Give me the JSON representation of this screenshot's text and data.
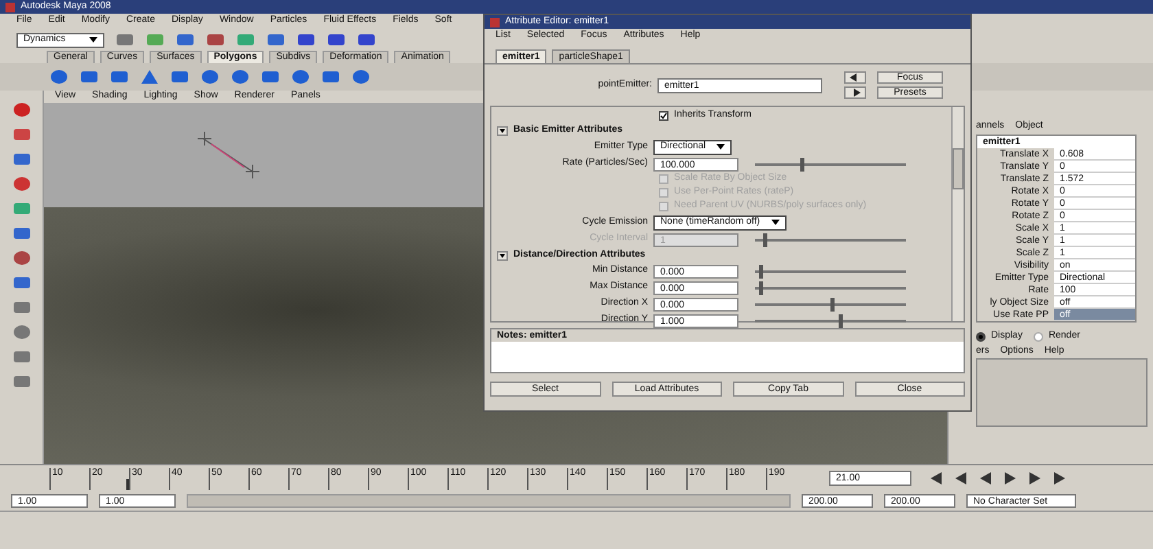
{
  "window": {
    "title": "Autodesk Maya 2008"
  },
  "menu_bar": [
    "File",
    "Edit",
    "Modify",
    "Create",
    "Display",
    "Window",
    "Particles",
    "Fluid Effects",
    "Fields",
    "Soft"
  ],
  "menu_set": {
    "value": "Dynamics"
  },
  "shelf_tabs": [
    {
      "label": "General",
      "selected": false
    },
    {
      "label": "Curves",
      "selected": false
    },
    {
      "label": "Surfaces",
      "selected": false
    },
    {
      "label": "Polygons",
      "selected": true
    },
    {
      "label": "Subdivs",
      "selected": false
    },
    {
      "label": "Deformation",
      "selected": false
    },
    {
      "label": "Animation",
      "selected": false
    }
  ],
  "viewport": {
    "menu": [
      "View",
      "Shading",
      "Lighting",
      "Show",
      "Renderer",
      "Panels"
    ]
  },
  "attribute_editor": {
    "title": "Attribute Editor: emitter1",
    "menu": [
      "List",
      "Selected",
      "Focus",
      "Attributes",
      "Help"
    ],
    "tabs": [
      {
        "label": "emitter1",
        "selected": true
      },
      {
        "label": "particleShape1",
        "selected": false
      }
    ],
    "node_label": "pointEmitter:",
    "node_value": "emitter1",
    "focus_button": "Focus",
    "presets_button": "Presets",
    "inherits": {
      "label": "Inherits Transform",
      "checked": true
    },
    "sections": [
      {
        "title": "Basic Emitter Attributes",
        "expanded": true,
        "rows": [
          {
            "kind": "dropdown",
            "label": "Emitter Type",
            "value": "Directional",
            "disabled": false
          },
          {
            "kind": "slider",
            "label": "Rate (Particles/Sec)",
            "value": "100.000",
            "level": 0.3,
            "disabled": false
          },
          {
            "kind": "checkbox",
            "label": "Scale Rate By Object Size",
            "checked": false,
            "disabled": true
          },
          {
            "kind": "checkbox",
            "label": "Use Per-Point Rates (rateP)",
            "checked": false,
            "disabled": true
          },
          {
            "kind": "checkbox",
            "label": "Need Parent UV (NURBS/poly surfaces only)",
            "checked": false,
            "disabled": true
          },
          {
            "kind": "dropdown",
            "label": "Cycle Emission",
            "value": "None (timeRandom off)",
            "disabled": false
          },
          {
            "kind": "slider",
            "label": "Cycle Interval",
            "value": "1",
            "level": 0.05,
            "disabled": true
          }
        ]
      },
      {
        "title": "Distance/Direction Attributes",
        "expanded": true,
        "rows": [
          {
            "kind": "slider",
            "label": "Min Distance",
            "value": "0.000",
            "level": 0.03,
            "disabled": false
          },
          {
            "kind": "slider",
            "label": "Max Distance",
            "value": "0.000",
            "level": 0.03,
            "disabled": false
          },
          {
            "kind": "slider",
            "label": "Direction X",
            "value": "0.000",
            "level": 0.5,
            "disabled": false
          },
          {
            "kind": "slider",
            "label": "Direction Y",
            "value": "1.000",
            "level": 0.55,
            "disabled": false
          }
        ]
      }
    ],
    "notes_label": "Notes:  emitter1",
    "buttons": [
      "Select",
      "Load Attributes",
      "Copy Tab",
      "Close"
    ]
  },
  "channel_box": {
    "tabs": [
      "annels",
      "Object"
    ],
    "node": "emitter1",
    "channels": [
      {
        "name": "Translate X",
        "value": "0.608",
        "selected": false
      },
      {
        "name": "Translate Y",
        "value": "0",
        "selected": false
      },
      {
        "name": "Translate Z",
        "value": "1.572",
        "selected": false
      },
      {
        "name": "Rotate X",
        "value": "0",
        "selected": false
      },
      {
        "name": "Rotate Y",
        "value": "0",
        "selected": false
      },
      {
        "name": "Rotate Z",
        "value": "0",
        "selected": false
      },
      {
        "name": "Scale X",
        "value": "1",
        "selected": false
      },
      {
        "name": "Scale Y",
        "value": "1",
        "selected": false
      },
      {
        "name": "Scale Z",
        "value": "1",
        "selected": false
      },
      {
        "name": "Visibility",
        "value": "on",
        "selected": false
      },
      {
        "name": "Emitter Type",
        "value": "Directional",
        "selected": false
      },
      {
        "name": "Rate",
        "value": "100",
        "selected": false
      },
      {
        "name": "ly Object Size",
        "value": "off",
        "selected": false
      },
      {
        "name": "Use Rate PP",
        "value": "off",
        "selected": true
      }
    ],
    "layer_modes": [
      {
        "label": "Display",
        "selected": true
      },
      {
        "label": "Render",
        "selected": false
      }
    ],
    "layer_menu": [
      "ers",
      "Options",
      "Help"
    ]
  },
  "time_slider": {
    "ticks": [
      "10",
      "20",
      "30",
      "40",
      "50",
      "60",
      "70",
      "80",
      "90",
      "100",
      "110",
      "120",
      "130",
      "140",
      "150",
      "160",
      "170",
      "180",
      "190"
    ],
    "current_time": "21.00",
    "level": 0.1
  },
  "range_slider": {
    "start": "1.00",
    "playback_start": "1.00",
    "playback_end": "200.00",
    "end": "200.00",
    "character_set": "No Character Set",
    "level": 1
  }
}
